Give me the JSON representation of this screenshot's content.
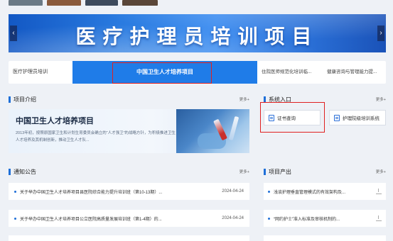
{
  "banner": {
    "title": "医疗护理员培训项目",
    "prev_label": "‹",
    "next_label": "›"
  },
  "tabs": [
    {
      "label": "医疗护理员培训"
    },
    {
      "label": "中国卫生人才培养项目"
    },
    {
      "label": "住院医师规范化培训临..."
    },
    {
      "label": "健康咨询与管理能力提..."
    }
  ],
  "project_intro": {
    "title": "项目介绍",
    "more": "更多+",
    "card_title": "中国卫生人才培养项目",
    "card_text": "2013年初，按照原国家卫生和计划生育委员会确立的“人才强卫”的战略方针，为积极推进卫生人才培养及其机制创新，推动卫生人才队..."
  },
  "system_entry": {
    "title": "系统入口",
    "more": "更多+",
    "buttons": [
      {
        "label": "证书查询"
      },
      {
        "label": "护理院级培训系统"
      }
    ]
  },
  "notices": {
    "title": "通知公告",
    "more": "更多+",
    "items": [
      {
        "text": "关于举办中国卫生人才培养项目县医院综合能力提升培训班（第10-13期）...",
        "date": "2024-04-24"
      },
      {
        "text": "关于举办中国卫生人才培养项目公立医院高质量发展培训班（第1-4期）的...",
        "date": "2024-04-24"
      }
    ]
  },
  "outputs": {
    "title": "项目产出",
    "more": "更多+",
    "items": [
      {
        "text": "浅谈护理垂直管理模式的有效架构及..."
      },
      {
        "text": "“网约护士”准入标准及审核机制的..."
      }
    ]
  }
}
